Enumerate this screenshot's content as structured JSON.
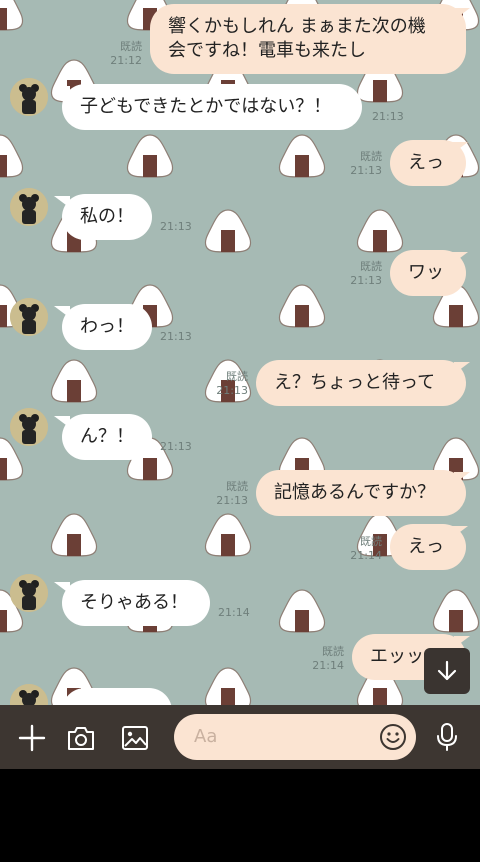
{
  "colors": {
    "chat_background": "#a6bab4",
    "incoming_bubble": "#ffffff",
    "outgoing_bubble": "#fbe4d2",
    "composer_bar": "#3d3631",
    "input_background": "#fbe4d2"
  },
  "messages": [
    {
      "direction": "out",
      "text": "響くかもしれん まぁまた次の機\n会ですね！電車も来たし",
      "read": "既読",
      "time": "21:12"
    },
    {
      "direction": "in",
      "text": "子どもできたとかではない？！",
      "time": "21:13"
    },
    {
      "direction": "out",
      "text": "えっ",
      "read": "既読",
      "time": "21:13"
    },
    {
      "direction": "in",
      "text": "私の！",
      "time": "21:13"
    },
    {
      "direction": "out",
      "text": "ワッ",
      "read": "既読",
      "time": "21:13"
    },
    {
      "direction": "in",
      "text": "わっ！",
      "time": "21:13"
    },
    {
      "direction": "out",
      "text": "え？ちょっと待って",
      "read": "既読",
      "time": "21:13"
    },
    {
      "direction": "in",
      "text": "ん？！",
      "time": "21:13"
    },
    {
      "direction": "out",
      "text": "記憶あるんですか？",
      "read": "既読",
      "time": "21:13"
    },
    {
      "direction": "out",
      "text": "えっ",
      "read": "既読",
      "time": "21:14"
    },
    {
      "direction": "in",
      "text": "そりゃある！",
      "time": "21:14"
    },
    {
      "direction": "out",
      "text": "エッッ",
      "read": "既読",
      "time": "21:14"
    }
  ],
  "composer": {
    "placeholder": "Aa",
    "icons": [
      "plus-icon",
      "camera-icon",
      "image-icon",
      "emoji-icon",
      "microphone-icon"
    ]
  },
  "scroll_button_icon": "arrow-down-icon"
}
